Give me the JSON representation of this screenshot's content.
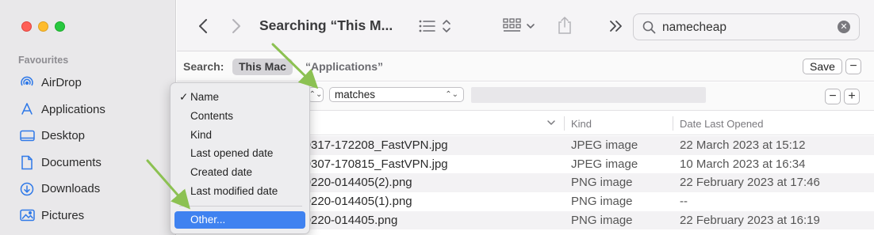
{
  "sidebar": {
    "heading": "Favourites",
    "items": [
      {
        "label": "AirDrop",
        "icon": "airdrop-icon"
      },
      {
        "label": "Applications",
        "icon": "applications-icon"
      },
      {
        "label": "Desktop",
        "icon": "desktop-icon"
      },
      {
        "label": "Documents",
        "icon": "documents-icon"
      },
      {
        "label": "Downloads",
        "icon": "downloads-icon"
      },
      {
        "label": "Pictures",
        "icon": "pictures-icon"
      }
    ]
  },
  "toolbar": {
    "title": "Searching “This M..."
  },
  "search": {
    "value": "namecheap"
  },
  "scope": {
    "label": "Search:",
    "this_mac": "This Mac",
    "applications": "“Applications”",
    "save": "Save",
    "minus": "−"
  },
  "criteria": {
    "operator": "matches",
    "minus": "−",
    "plus": "+"
  },
  "table": {
    "columns": [
      "Kind",
      "Date Last Opened"
    ],
    "rows": [
      {
        "name": "230317-172208_FastVPN.jpg",
        "kind": "JPEG image",
        "date": "22 March 2023 at 15:12"
      },
      {
        "name": "230307-170815_FastVPN.jpg",
        "kind": "JPEG image",
        "date": "10 March 2023 at 16:34"
      },
      {
        "name": "230220-014405(2).png",
        "kind": "PNG image",
        "date": "22 February 2023 at 17:46"
      },
      {
        "name": "230220-014405(1).png",
        "kind": "PNG image",
        "date": "--"
      },
      {
        "name": "230220-014405.png",
        "kind": "PNG image",
        "date": "22 February 2023 at 16:19"
      }
    ]
  },
  "menu": {
    "checkmark": "✓",
    "items": [
      "Name",
      "Contents",
      "Kind",
      "Last opened date",
      "Created date",
      "Last modified date"
    ],
    "other": "Other..."
  },
  "colors": {
    "accent": "#3f82f0",
    "annotation_arrow": "#8cc152"
  }
}
